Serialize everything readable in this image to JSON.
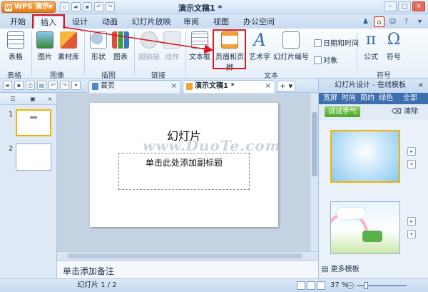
{
  "app": {
    "name": "WPS 演示",
    "doc_title": "演示文稿1 *"
  },
  "tabs": [
    {
      "label": "开始"
    },
    {
      "label": "插入"
    },
    {
      "label": "设计"
    },
    {
      "label": "动画"
    },
    {
      "label": "幻灯片放映"
    },
    {
      "label": "审阅"
    },
    {
      "label": "视图"
    },
    {
      "label": "办公空间"
    }
  ],
  "ribbon": {
    "buttons": [
      {
        "label": "表格"
      },
      {
        "label": "图片"
      },
      {
        "label": "素材库"
      },
      {
        "label": "形状"
      },
      {
        "label": "图表"
      },
      {
        "label": "超链接"
      },
      {
        "label": "动作"
      },
      {
        "label": "文本框"
      },
      {
        "label": "页眉和页脚"
      },
      {
        "label": "艺术字"
      },
      {
        "label": "幻灯片编号"
      },
      {
        "label": "公式"
      },
      {
        "label": "符号"
      }
    ],
    "small_items": [
      {
        "label": "日期和时间"
      },
      {
        "label": "对象"
      }
    ],
    "groups": [
      {
        "label": "表格"
      },
      {
        "label": "图像"
      },
      {
        "label": "插图"
      },
      {
        "label": "链接"
      },
      {
        "label": "文本"
      },
      {
        "label": "符号"
      }
    ]
  },
  "doc_tabs": [
    {
      "label": "首页"
    },
    {
      "label": "演示文稿1 *"
    }
  ],
  "thumbnails": [
    {
      "num": "1"
    },
    {
      "num": "2"
    }
  ],
  "slide": {
    "title": "幻灯片",
    "subtitle_placeholder": "单击此处添加副标题",
    "watermark": "www.DuoTe.com"
  },
  "notes_placeholder": "单击添加备注",
  "right_pane": {
    "title": "幻灯片设计 - 在线模板",
    "filters": [
      {
        "label": "宽屏"
      },
      {
        "label": "时尚"
      },
      {
        "label": "简约"
      },
      {
        "label": "绿色"
      },
      {
        "label": "全部"
      }
    ],
    "try_button": "试试手气",
    "clear_button": "清除",
    "more_templates": "更多模板"
  },
  "status": {
    "pages": "幻灯片 1 / 2",
    "zoom": "37 %"
  },
  "colors": {
    "highlight": "#e0141c",
    "app_orange": "#e97a16",
    "accent_blue": "#3d6fae"
  }
}
